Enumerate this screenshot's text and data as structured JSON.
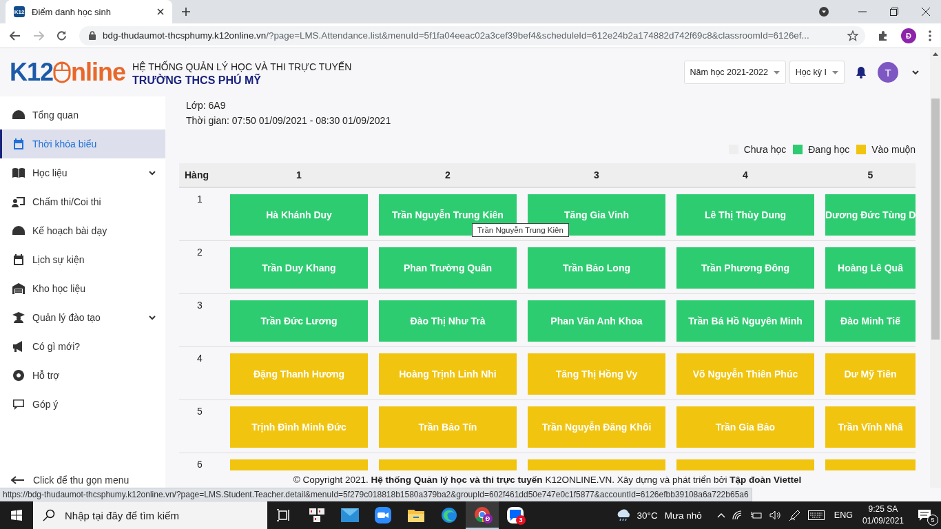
{
  "browser": {
    "tab": {
      "favicon": "K12",
      "title": "Điểm danh học sinh"
    },
    "address": {
      "host": "bdg-thudaumot-thcsphumy.k12online.vn",
      "path": "/?page=LMS.Attendance.list&menuId=5f1fa04eeac02a3cef39bef4&scheduleId=612e24b2a174882d742f69c8&classroomId=6126ef..."
    },
    "profile": "Đ"
  },
  "header": {
    "logo": {
      "left": "K12",
      "right": "nline"
    },
    "system_title": "HỆ THỐNG QUẢN LÝ HỌC VÀ THI TRỰC TUYẾN",
    "school": "TRƯỜNG THCS PHÚ MỸ",
    "selects": [
      {
        "value": "Năm học 2021-2022"
      },
      {
        "value": "Học kỳ I"
      }
    ],
    "avatar": "T"
  },
  "sidebar": {
    "items": [
      {
        "label": "Tổng quan",
        "kind": "gauge",
        "selected": false,
        "expandable": false
      },
      {
        "label": "Thời khóa biểu",
        "kind": "calendar",
        "selected": true,
        "expandable": false
      },
      {
        "label": "Học liệu",
        "kind": "book",
        "selected": false,
        "expandable": true
      },
      {
        "label": "Chấm thi/Coi thi",
        "kind": "teacher",
        "selected": false,
        "expandable": false
      },
      {
        "label": "Kế hoạch bài dạy",
        "kind": "gauge",
        "selected": false,
        "expandable": false
      },
      {
        "label": "Lịch sự kiện",
        "kind": "calendar",
        "selected": false,
        "expandable": false
      },
      {
        "label": "Kho học liệu",
        "kind": "warehouse",
        "selected": false,
        "expandable": false
      },
      {
        "label": "Quản lý đào tạo",
        "kind": "graduate",
        "selected": false,
        "expandable": true
      },
      {
        "label": "Có gì mới?",
        "kind": "megaphone",
        "selected": false,
        "expandable": false
      },
      {
        "label": "Hỗ trợ",
        "kind": "lifebuoy",
        "selected": false,
        "expandable": false
      },
      {
        "label": "Góp ý",
        "kind": "comment",
        "selected": false,
        "expandable": false
      }
    ],
    "collapse": "Click để thu gọn menu"
  },
  "info": [
    "Lớp: 6A9",
    "Thời gian: 07:50 01/09/2021 - 08:30 01/09/2021"
  ],
  "legend": [
    {
      "label": "Chưa học",
      "color": "#eeeeee"
    },
    {
      "label": "Đang học",
      "color": "#2ecc71"
    },
    {
      "label": "Vào muộn",
      "color": "#f1c40f"
    }
  ],
  "table": {
    "columns": [
      "Hàng",
      "1",
      "2",
      "3",
      "4",
      "5"
    ],
    "rows": [
      {
        "cells": [
          {
            "kind": "number",
            "name": "1"
          },
          {
            "kind": "present",
            "name": "Hà Khánh Duy"
          },
          {
            "kind": "present",
            "name": "Trần Nguyễn Trung Kiên"
          },
          {
            "kind": "present",
            "name": "Tăng Gia Vinh"
          },
          {
            "kind": "present",
            "name": "Lê Thị Thùy Dung"
          },
          {
            "kind": "present",
            "name": "Dương Đức Tùng D"
          }
        ]
      },
      {
        "cells": [
          {
            "kind": "number",
            "name": "2"
          },
          {
            "kind": "present",
            "name": "Trần Duy Khang"
          },
          {
            "kind": "present",
            "name": "Phan Trường Quân"
          },
          {
            "kind": "present",
            "name": "Trần Bảo Long"
          },
          {
            "kind": "present",
            "name": "Trần Phương Đông"
          },
          {
            "kind": "present",
            "name": "Hoàng Lê Quâ"
          }
        ]
      },
      {
        "cells": [
          {
            "kind": "number",
            "name": "3"
          },
          {
            "kind": "present",
            "name": "Trần Đức Lương"
          },
          {
            "kind": "present",
            "name": "Đào Thị Như Trà"
          },
          {
            "kind": "present",
            "name": "Phan Văn Anh Khoa"
          },
          {
            "kind": "present",
            "name": "Trần Bá Hồ Nguyên Minh"
          },
          {
            "kind": "present",
            "name": "Đào Minh Tiế"
          }
        ]
      },
      {
        "cells": [
          {
            "kind": "number",
            "name": "4"
          },
          {
            "kind": "late",
            "name": "Đặng Thanh Hương"
          },
          {
            "kind": "late",
            "name": "Hoàng Trịnh Linh Nhi"
          },
          {
            "kind": "late",
            "name": "Tăng Thị Hồng Vy"
          },
          {
            "kind": "late",
            "name": "Võ Nguyễn Thiên Phúc"
          },
          {
            "kind": "late",
            "name": "Dư Mỹ Tiên"
          }
        ]
      },
      {
        "cells": [
          {
            "kind": "number",
            "name": "5"
          },
          {
            "kind": "late",
            "name": "Trịnh Đình Minh Đức"
          },
          {
            "kind": "late",
            "name": "Trần Bảo Tín"
          },
          {
            "kind": "late",
            "name": "Trần Nguyễn Đăng Khôi"
          },
          {
            "kind": "late",
            "name": "Trần Gia Bảo"
          },
          {
            "kind": "late",
            "name": "Trần Vĩnh Nhâ"
          }
        ]
      },
      {
        "cells": [
          {
            "kind": "number",
            "name": "6"
          },
          {
            "kind": "late"
          },
          {
            "kind": "late"
          },
          {
            "kind": "late"
          },
          {
            "kind": "late"
          },
          {
            "kind": "late"
          }
        ]
      }
    ]
  },
  "tooltip": "Trần Nguyễn Trung Kiên",
  "footer": "© Copyright 2021. **Hệ thống Quản lý học và thi trực tuyến** K12ONLINE.VN. Xây dựng và phát triển bởi **Tập đoàn Viettel**",
  "status_url": "https://bdg-thudaumot-thcsphumy.k12online.vn/?page=LMS.Student.Teacher.detail&menuId=5f279c018818b1580a379ba2&groupId=602f461dd50e747e0c1f5877&accountId=6126efbb39108a6a722b65a6",
  "taskbar": {
    "search": {
      "placeholder": "Nhập tại đây để tìm kiếm"
    },
    "apps": [
      {
        "kind": "taskview",
        "selected": false
      },
      {
        "kind": "keyboard-tool",
        "selected": false
      },
      {
        "kind": "mail",
        "selected": false
      },
      {
        "kind": "video",
        "selected": false
      },
      {
        "kind": "folder",
        "selected": false
      },
      {
        "kind": "browser-wave",
        "selected": false
      },
      {
        "kind": "browser-round",
        "selected": true,
        "badge": "Đ"
      },
      {
        "kind": "chat",
        "selected": false,
        "badge": "3"
      }
    ],
    "weather": {
      "temp": "30°C",
      "condition": "Mưa nhỏ"
    },
    "language": "ENG",
    "time": "9:25 SA",
    "date": "01/09/2021",
    "notifications": "5"
  }
}
